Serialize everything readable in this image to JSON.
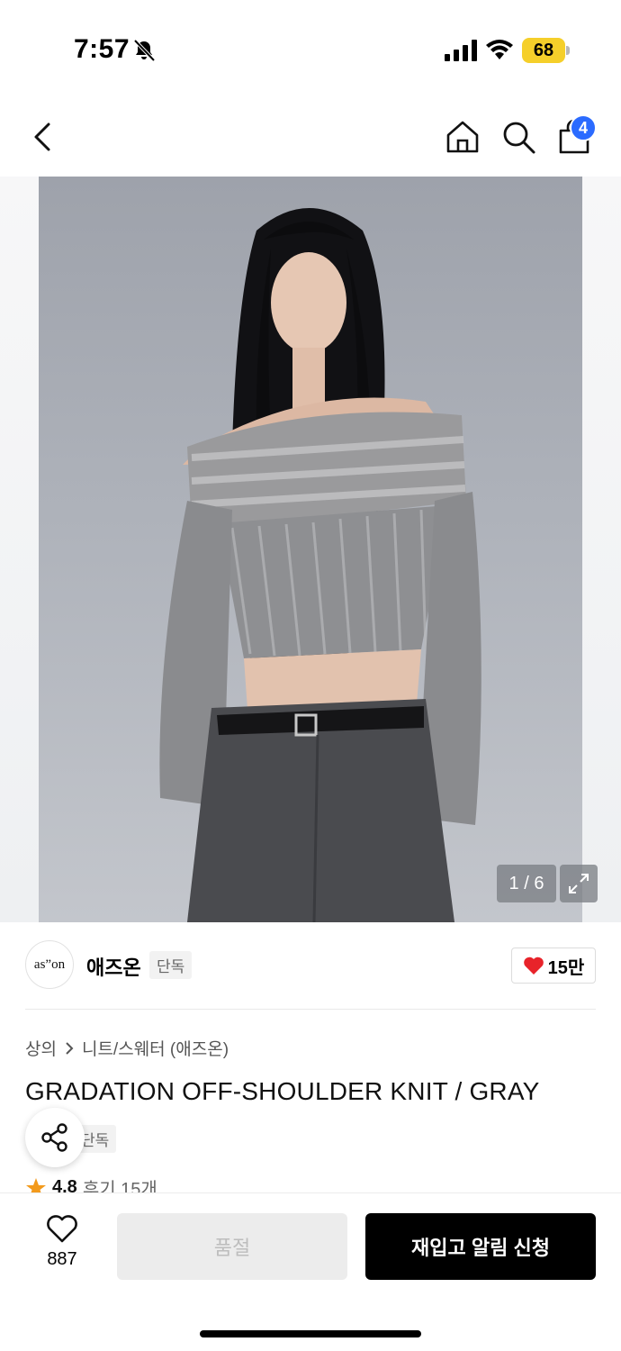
{
  "status_bar": {
    "time": "7:57",
    "battery": "68",
    "battery_color": "#f5cf2a"
  },
  "nav": {
    "cart_count": "4",
    "badge_color": "#2b6bff",
    "icons": [
      "chevron-left-icon",
      "home-icon",
      "search-icon",
      "shopping-bag-icon"
    ]
  },
  "gallery": {
    "page_indicator": "1 / 6"
  },
  "brand": {
    "logo_text": "as”on",
    "name": "애즈온",
    "badge": "단독",
    "likes": "15만"
  },
  "product": {
    "breadcrumb": [
      "상의",
      "니트/스웨터 (애즈온)"
    ],
    "title": "GRADATION OFF-SHOULDER KNIT / GRAY",
    "exclusive_tag": "단독",
    "rating": "4.8",
    "reviews": "후기 15개"
  },
  "actions": {
    "wish_count": "887",
    "soldout_label": "품절",
    "restock_label": "재입고 알림 신청"
  }
}
